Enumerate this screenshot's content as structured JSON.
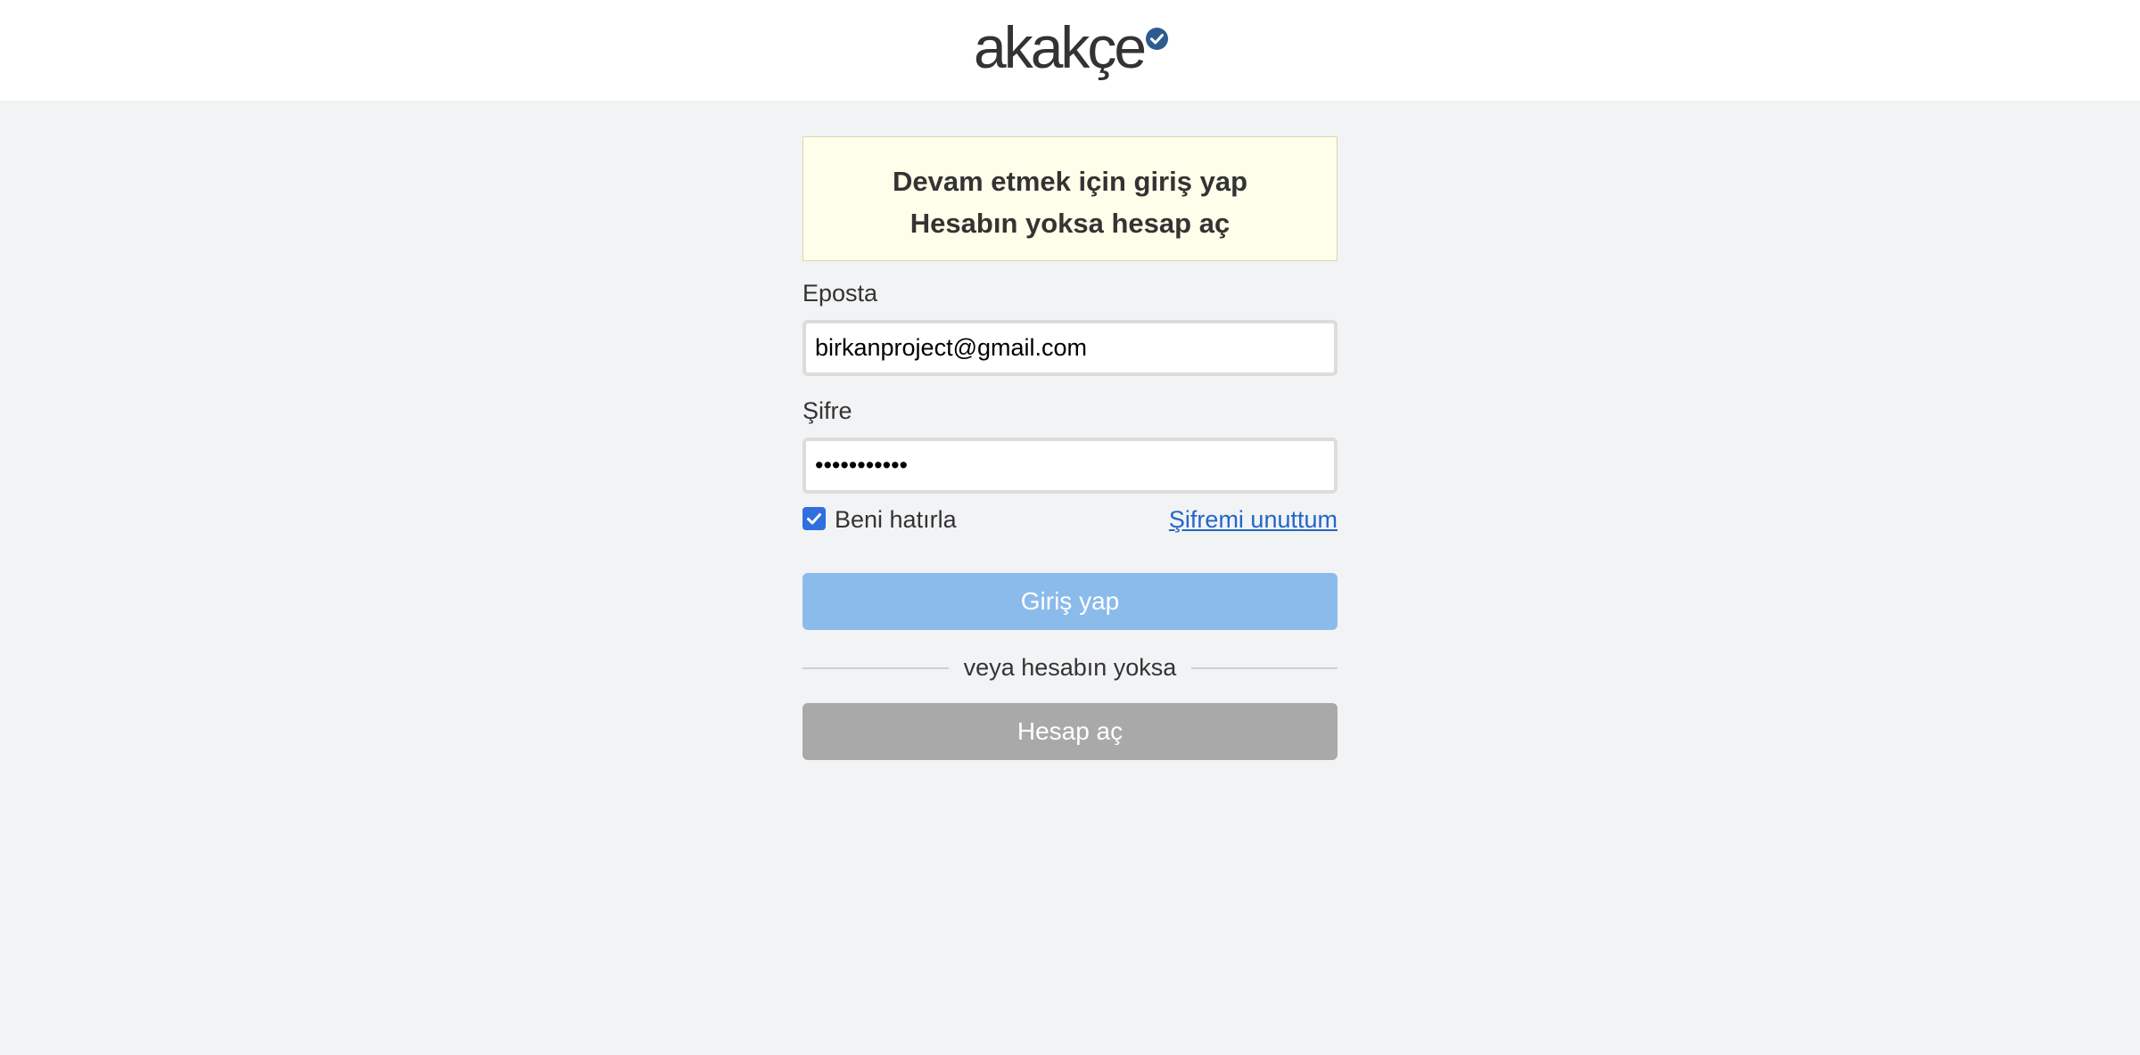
{
  "header": {
    "logo_text": "akakçe"
  },
  "notice": {
    "line1": "Devam etmek için giriş yap",
    "line2": "Hesabın yoksa hesap aç"
  },
  "form": {
    "email_label": "Eposta",
    "email_value": "birkanproject@gmail.com",
    "password_label": "Şifre",
    "password_value": "•••••••••••",
    "remember_label": "Beni hatırla",
    "remember_checked": true,
    "forgot_link": "Şifremi unuttum",
    "login_button": "Giriş yap",
    "divider_text": "veya hesabın yoksa",
    "register_button": "Hesap aç"
  },
  "colors": {
    "accent": "#2f6fe0",
    "login_button": "#8bbbeb",
    "register_button": "#a9a9a9",
    "notice_background": "#fefeea",
    "link": "#2466c8",
    "logo_badge": "#2d5b8f"
  }
}
